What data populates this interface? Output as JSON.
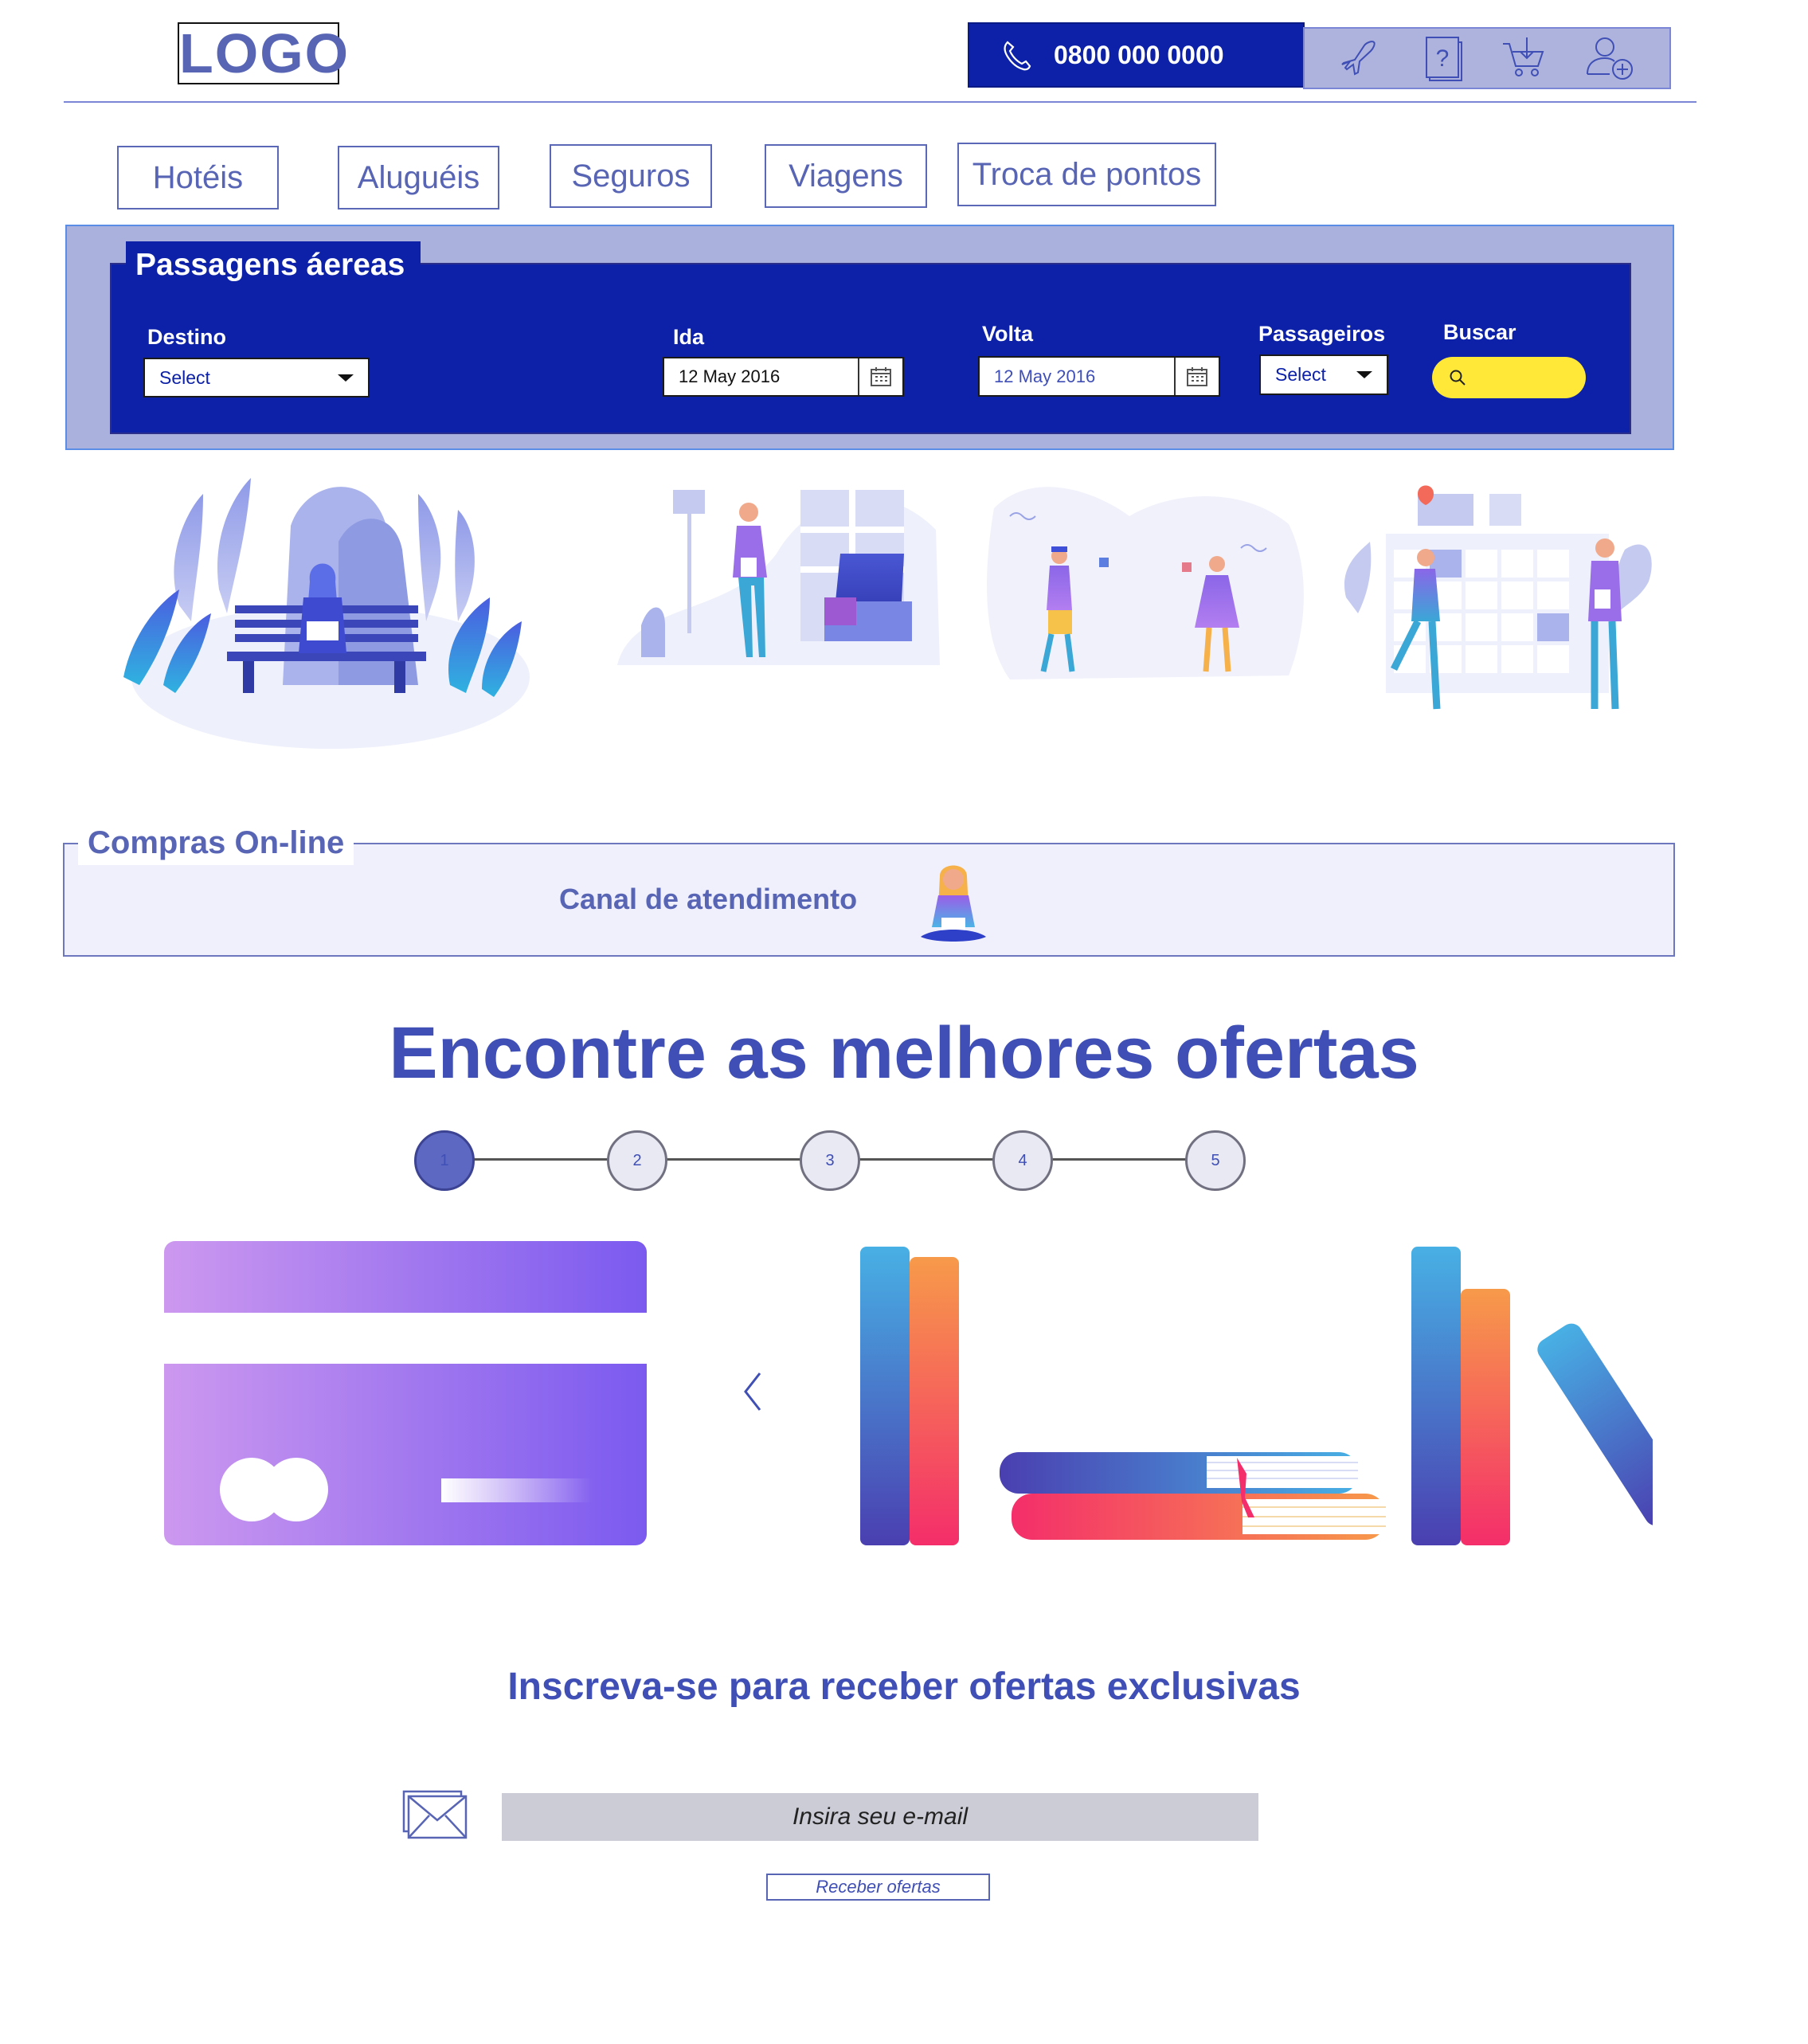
{
  "header": {
    "logo": "LOGO",
    "phone": "0800 000 0000",
    "icons": [
      "plane-icon",
      "help-book-icon",
      "cart-icon",
      "add-user-icon"
    ]
  },
  "nav": {
    "tabs": [
      {
        "label": "Hotéis"
      },
      {
        "label": "Aluguéis"
      },
      {
        "label": "Seguros"
      },
      {
        "label": "Viagens"
      },
      {
        "label": "Troca de pontos"
      }
    ]
  },
  "search": {
    "title": "Passagens áereas",
    "destino_label": "Destino",
    "destino_value": "Select",
    "ida_label": "Ida",
    "ida_value": "12 May 2016",
    "volta_label": "Volta",
    "volta_value": "12 May 2016",
    "passageiros_label": "Passageiros",
    "passageiros_value": "Select",
    "buscar_label": "Buscar"
  },
  "compras": {
    "label": "Compras On-line",
    "canal": "Canal de atendimento"
  },
  "offers": {
    "title": "Encontre as melhores ofertas",
    "steps": [
      "1",
      "2",
      "3",
      "4",
      "5"
    ],
    "active_step": "1"
  },
  "newsletter": {
    "title": "Inscreva-se para receber ofertas exclusivas",
    "email_placeholder": "Insira seu e-mail",
    "button": "Receber ofertas"
  },
  "colors": {
    "primary": "#0c21a8",
    "accent_text": "#3f4fb5",
    "search_button": "#ffe838",
    "panel_bg": "#aab1dd"
  }
}
